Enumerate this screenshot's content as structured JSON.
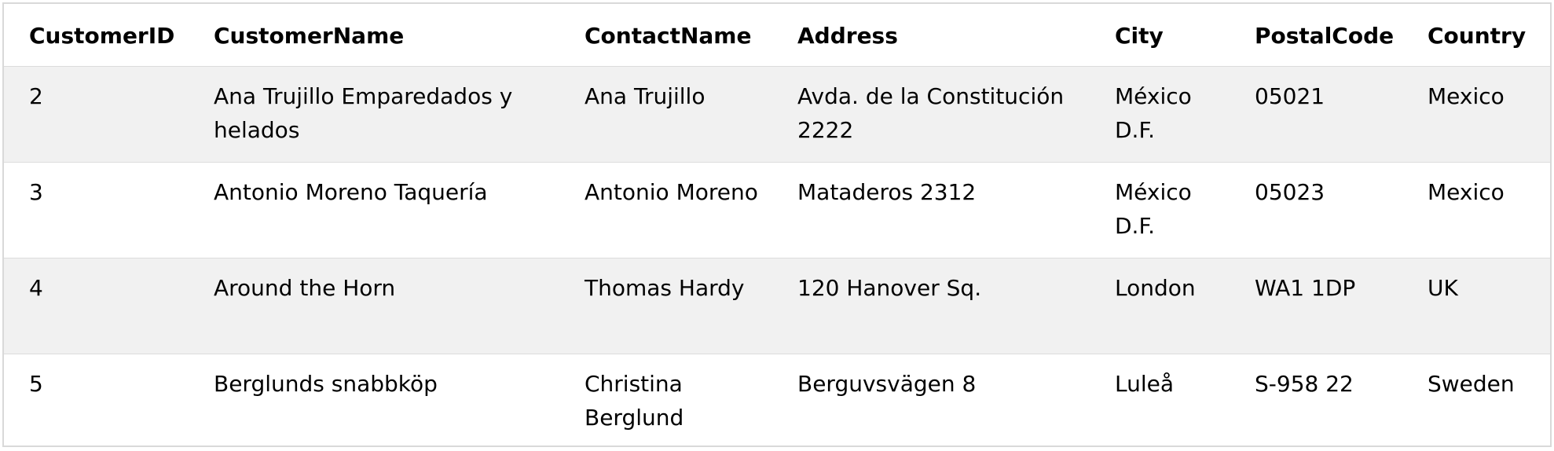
{
  "table": {
    "headers": [
      "CustomerID",
      "CustomerName",
      "ContactName",
      "Address",
      "City",
      "PostalCode",
      "Country"
    ],
    "rows": [
      [
        "2",
        "Ana Trujillo Emparedados y helados",
        "Ana Trujillo",
        "Avda. de la Constitución 2222",
        "México D.F.",
        "05021",
        "Mexico"
      ],
      [
        "3",
        "Antonio Moreno Taquería",
        "Antonio Moreno",
        "Mataderos 2312",
        "México D.F.",
        "05023",
        "Mexico"
      ],
      [
        "4",
        "Around the Horn",
        "Thomas Hardy",
        "120 Hanover Sq.",
        "London",
        "WA1 1DP",
        "UK"
      ],
      [
        "5",
        "Berglunds snabbköp",
        "Christina Berglund",
        "Berguvsvägen 8",
        "Luleå",
        "S-958 22",
        "Sweden"
      ]
    ]
  },
  "colors": {
    "alt_row_background": "#f1f1f1",
    "border": "#d9d9d9",
    "divider": "#dcdcdc"
  }
}
